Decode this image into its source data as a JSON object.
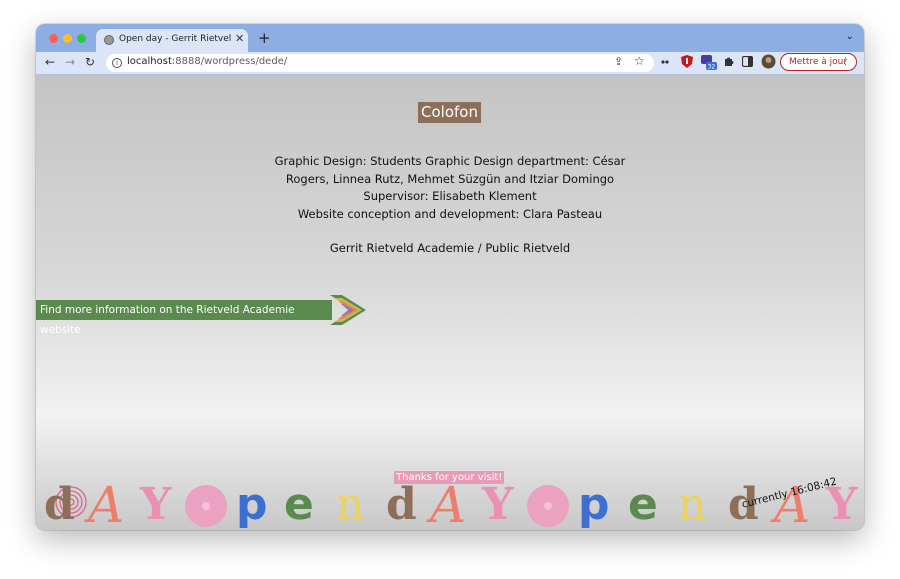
{
  "browser": {
    "tab_title": "Open day - Gerrit Rietveld Academie",
    "new_tab": "+",
    "tab_close": "✕",
    "tab_menu": "⌄",
    "url_host": "localhost",
    "url_rest": ":8888/wordpress/dede/",
    "update_button": "Mettre à jour",
    "extension_badge": "32",
    "icons": {
      "back": "←",
      "forward": "→",
      "reload": "↻",
      "share": "⇪",
      "star": "☆",
      "more": "⋮"
    }
  },
  "page": {
    "colofon_title": "Colofon",
    "credits": {
      "line1": "Graphic Design: Students Graphic Design department: César",
      "line2": "Rogers, Linnea Rutz, Mehmet Süzgün and Itziar Domingo",
      "line3": "Supervisor: Elisabeth Klement",
      "line4": "Website conception and development: Clara Pasteau",
      "org": "Gerrit Rietveld Academie / Public Rietveld"
    },
    "info_link": "Find more information on the Rietveld Academie website",
    "thanks": "Thanks for your visit!",
    "clock_label": "currently",
    "clock_time": "16:08:42"
  },
  "banner_letters": [
    "d",
    "A",
    "Y",
    "",
    "p",
    "e",
    "n",
    "d",
    "A",
    "Y",
    "",
    "p",
    "e",
    "n",
    "d",
    "A",
    "Y"
  ],
  "colors": {
    "tabstrip": "#8eaee3",
    "toolbar": "#dbe5f7",
    "colofon_bg": "#8d6e58",
    "link_bg": "#5a8a4e",
    "thanks_bg": "#e89ab9",
    "update_red": "#b3261e"
  }
}
